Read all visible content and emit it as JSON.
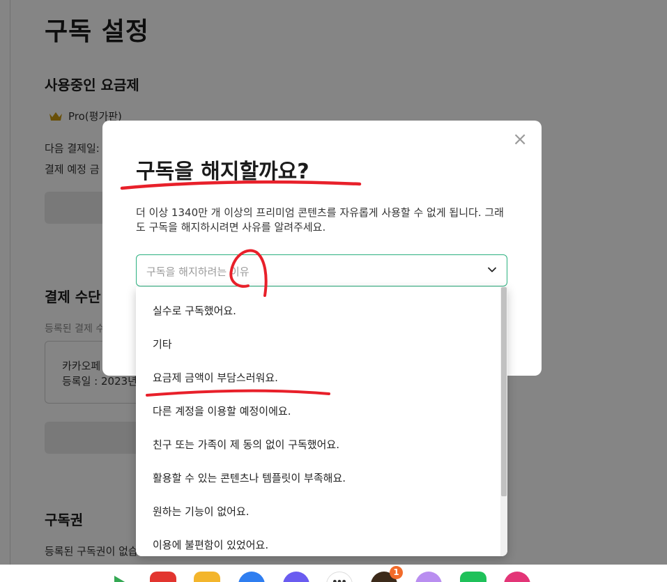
{
  "page": {
    "title": "구독 설정",
    "current_plan": {
      "heading": "사용중인 요금제",
      "plan_name": "Pro(평가판)",
      "next_payment_label": "다음 결제일:",
      "expected_amount_label": "결제 예정 금"
    },
    "payment_method": {
      "heading": "결제 수단",
      "registered_label": "등록된 결제 수",
      "card_name": "카카오페",
      "card_date": "등록일 : 2023년"
    },
    "subscription_voucher": {
      "heading": "구독권",
      "none_text": "등록된 구독권이 없습"
    }
  },
  "modal": {
    "close_glyph": "×",
    "title": "구독을 해지할까요?",
    "description": "더 이상 1340만 개 이상의 프리미엄 콘텐츠를 자유롭게 사용할 수 없게 됩니다. 그래도 구독을 해지하시려면 사유를 알려주세요.",
    "select_placeholder": "구독을 해지하려는 이유"
  },
  "dropdown": {
    "options": [
      "실수로 구독했어요.",
      "기타",
      "요금제 금액이 부담스러워요.",
      "다른 계정을 이용할 예정이에요.",
      "친구 또는 가족이 제 동의 없이 구독했어요.",
      "활용할 수 있는 콘텐츠나 템플릿이 부족해요.",
      "원하는 기능이 없어요.",
      "이용에 불편함이 있었어요."
    ]
  },
  "taskbar": {
    "badge_count": "1",
    "apps": [
      "play-store-icon",
      "red-app-icon",
      "files-icon",
      "messages-icon",
      "chat-icon",
      "more-apps-icon",
      "kakaotalk-icon",
      "purple-app-icon",
      "green-app-icon",
      "flower-app-icon"
    ]
  },
  "colors": {
    "accent_green": "#2bb07f",
    "annotation_red": "#e8202a",
    "overlay": "rgba(0,0,0,0.48)"
  }
}
